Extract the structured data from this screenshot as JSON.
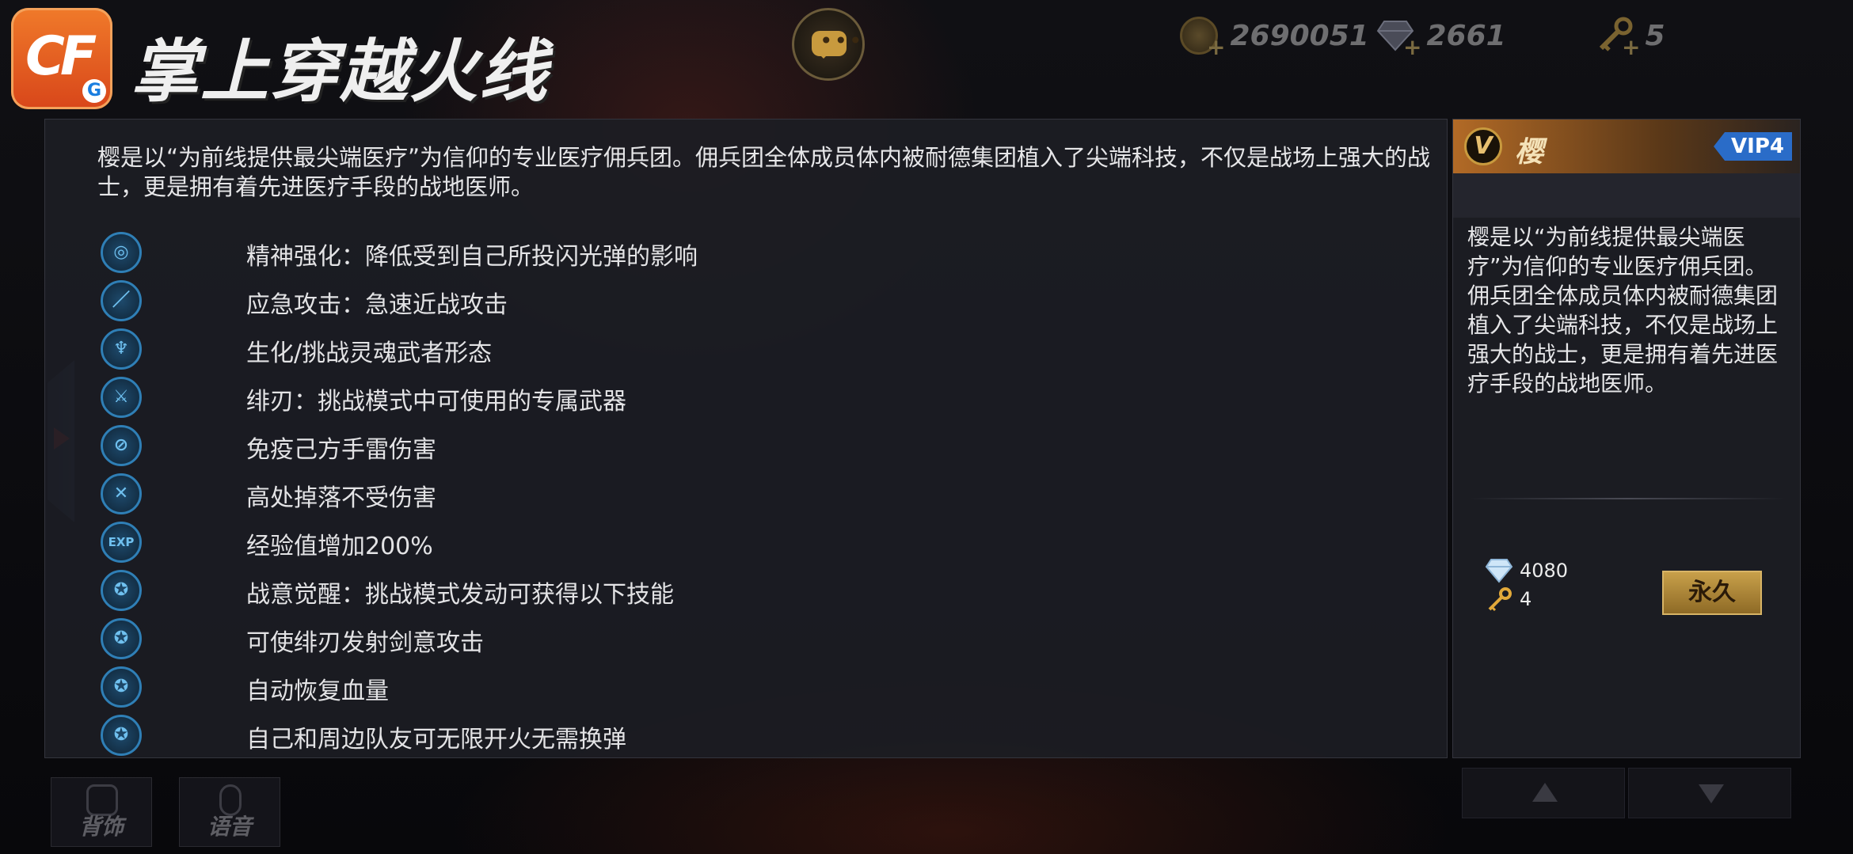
{
  "app": {
    "title": "掌上穿越火线",
    "logo_text": "CF",
    "logo_badge": "G"
  },
  "currencies": [
    {
      "icon": "coin-icon",
      "value": "2690051"
    },
    {
      "icon": "diamond-icon",
      "value": "2661"
    },
    {
      "icon": "key-icon",
      "value": "5"
    }
  ],
  "main": {
    "intro": "樱是以“为前线提供最尖端医疗”为信仰的专业医疗佣兵团。佣兵团全体成员体内被耐德集团植入了尖端科技，不仅是战场上强大的战士，更是拥有着先进医疗手段的战地医师。",
    "skills": [
      {
        "icon": "eye-mask-icon",
        "glyph": "◎",
        "text": "精神强化：降低受到自己所投闪光弹的影响"
      },
      {
        "icon": "knife-icon",
        "glyph": "／",
        "text": "应急攻击：急速近战攻击"
      },
      {
        "icon": "soul-warrior-icon",
        "glyph": "♆",
        "text": "生化/挑战灵魂武者形态"
      },
      {
        "icon": "blade-icon",
        "glyph": "⚔",
        "text": "绯刃：挑战模式中可使用的专属武器"
      },
      {
        "icon": "no-grenade-icon",
        "glyph": "⊘",
        "text": "免疫己方手雷伤害"
      },
      {
        "icon": "no-fall-damage-icon",
        "glyph": "✕",
        "text": "高处掉落不受伤害"
      },
      {
        "icon": "exp-icon",
        "glyph": "EXP",
        "text": "经验值增加200%"
      },
      {
        "icon": "strength-icon",
        "glyph": "✪",
        "text": "战意觉醒：挑战模式发动可获得以下技能"
      },
      {
        "icon": "strength-icon",
        "glyph": "✪",
        "text": "可使绯刃发射剑意攻击"
      },
      {
        "icon": "strength-icon",
        "glyph": "✪",
        "text": "自动恢复血量"
      },
      {
        "icon": "strength-icon",
        "glyph": "✪",
        "text": "自己和周边队友可无限开火无需换弹"
      }
    ]
  },
  "side": {
    "badge": "V",
    "name": "樱",
    "vip": "VIP4",
    "description": "樱是以“为前线提供最尖端医疗”为信仰的专业医疗佣兵团。佣兵团全体成员体内被耐德集团植入了尖端科技，不仅是战场上强大的战士，更是拥有着先进医疗手段的战地医师。",
    "price_diamond": "4080",
    "price_key": "4",
    "buy_label": "永久"
  },
  "bottom": {
    "tab1": "背饰",
    "tab2": "语音"
  },
  "colors": {
    "accent": "#c89a3e",
    "skill_blue": "#2f7fb6",
    "vip_blue": "#2a6cc8"
  }
}
